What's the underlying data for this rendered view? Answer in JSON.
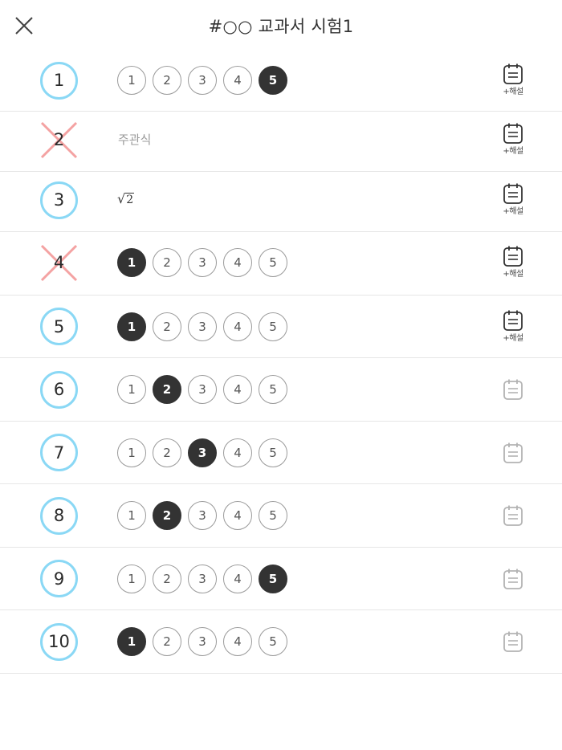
{
  "header": {
    "title": "#○○ 교과서 시험1"
  },
  "solution_label": "+해설",
  "subjective_label": "주관식",
  "colors": {
    "correct_ring": "#8ad8f5",
    "wrong_cross": "#f4a2a2",
    "selected_choice": "#333333",
    "solution_active": "#333333",
    "solution_inactive": "#b3b3b3"
  },
  "choice_labels": [
    "1",
    "2",
    "3",
    "4",
    "5"
  ],
  "questions": [
    {
      "number": "1",
      "result": "correct",
      "type": "choice",
      "selected": "5",
      "solution": true
    },
    {
      "number": "2",
      "result": "wrong",
      "type": "subjective",
      "answer": "주관식",
      "solution": true
    },
    {
      "number": "3",
      "result": "correct",
      "type": "math",
      "answer_radicand": "2",
      "solution": true
    },
    {
      "number": "4",
      "result": "wrong",
      "type": "choice",
      "selected": "1",
      "solution": true
    },
    {
      "number": "5",
      "result": "correct",
      "type": "choice",
      "selected": "1",
      "solution": true
    },
    {
      "number": "6",
      "result": "correct",
      "type": "choice",
      "selected": "2",
      "solution": false
    },
    {
      "number": "7",
      "result": "correct",
      "type": "choice",
      "selected": "3",
      "solution": false
    },
    {
      "number": "8",
      "result": "correct",
      "type": "choice",
      "selected": "2",
      "solution": false
    },
    {
      "number": "9",
      "result": "correct",
      "type": "choice",
      "selected": "5",
      "solution": false
    },
    {
      "number": "10",
      "result": "correct",
      "type": "choice",
      "selected": "1",
      "solution": false
    }
  ]
}
